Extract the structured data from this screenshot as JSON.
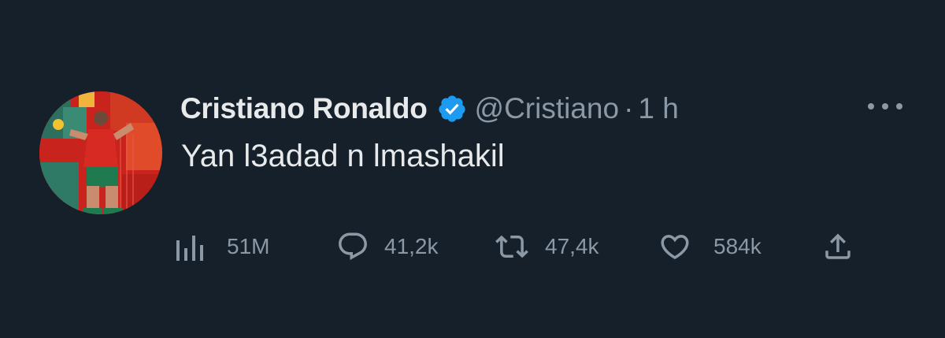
{
  "tweet": {
    "author_name": "Cristiano Ronaldo",
    "handle": "@Cristiano",
    "separator": "·",
    "time": "1 h",
    "text": "Yan l3adad n lmashakil"
  },
  "metrics": {
    "views": "51M",
    "replies": "41,2k",
    "retweets": "47,4k",
    "likes": "584k"
  },
  "icons": {
    "verified": "verified-badge-icon",
    "more": "more-icon",
    "views": "views-icon",
    "reply": "reply-icon",
    "retweet": "retweet-icon",
    "like": "like-icon",
    "share": "share-icon"
  },
  "colors": {
    "background": "#15202b",
    "primary_text": "#e7e9ea",
    "secondary_text": "#8b98a5",
    "verified_blue": "#1d9bf0"
  }
}
